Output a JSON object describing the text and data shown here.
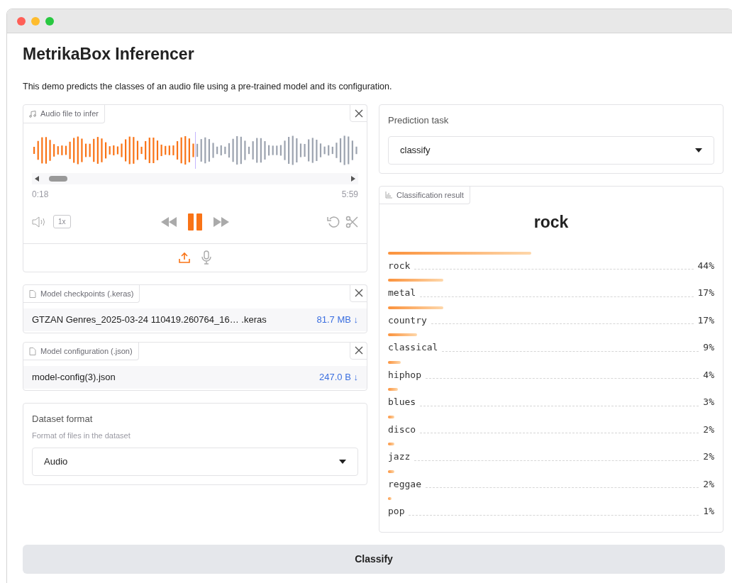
{
  "app": {
    "title": "MetrikaBox Inferencer",
    "description": "This demo predicts the classes of an audio file using a pre-trained model and its configuration."
  },
  "audio": {
    "label": "Audio file to infer",
    "level": 0.5,
    "current_time": "0:18",
    "duration": "5:59",
    "speed": "1x",
    "playing": true
  },
  "files": [
    {
      "label": "Model checkpoints (.keras)",
      "name": "GTZAN Genres_2025-03-24 110419.260764_16… .keras",
      "size": "81.7 MB ↓"
    },
    {
      "label": "Model configuration (.json)",
      "name": "model-config(3).json",
      "size": "247.0 B ↓"
    }
  ],
  "dataset_format": {
    "label": "Dataset format",
    "info": "Format of files in the dataset",
    "value": "Audio"
  },
  "prediction_task": {
    "label": "Prediction task",
    "value": "classify"
  },
  "result": {
    "label": "Classification result",
    "top": "rock",
    "confidences": [
      {
        "name": "rock",
        "value": "44%"
      },
      {
        "name": "metal",
        "value": "17%"
      },
      {
        "name": "country",
        "value": "17%"
      },
      {
        "name": "classical",
        "value": "9%"
      },
      {
        "name": "hiphop",
        "value": "4%"
      },
      {
        "name": "blues",
        "value": "3%"
      },
      {
        "name": "disco",
        "value": "2%"
      },
      {
        "name": "jazz",
        "value": "2%"
      },
      {
        "name": "reggae",
        "value": "2%"
      },
      {
        "name": "pop",
        "value": "1%"
      }
    ]
  },
  "buttons": [
    {
      "label": "Classify"
    }
  ]
}
